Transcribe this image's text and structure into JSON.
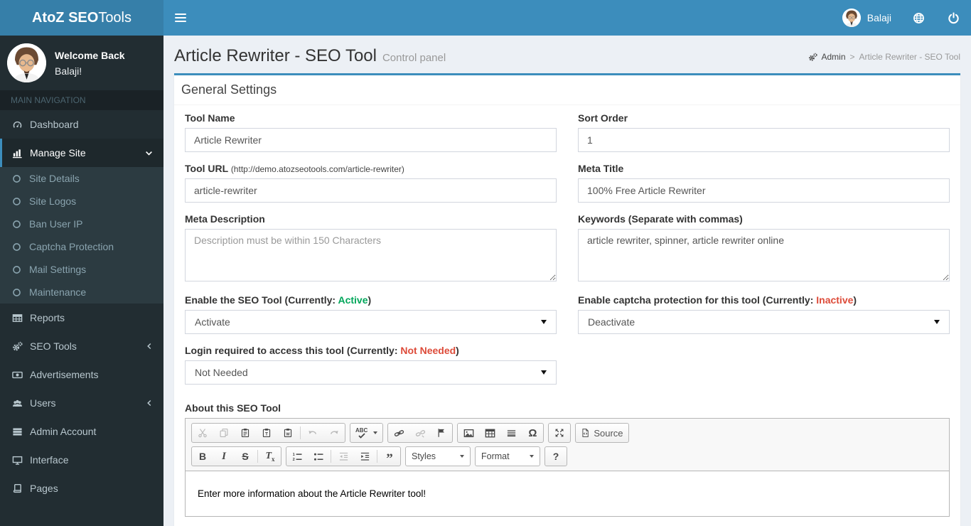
{
  "header": {
    "logo": {
      "bold": "AtoZ SEO",
      "light": "Tools"
    },
    "user_name": "Balaji"
  },
  "sidebar": {
    "welcome_title": "Welcome Back",
    "welcome_name": "Balaji!",
    "section_header": "MAIN NAVIGATION",
    "items": [
      {
        "label": "Dashboard"
      },
      {
        "label": "Manage Site"
      },
      {
        "label": "Reports"
      },
      {
        "label": "SEO Tools"
      },
      {
        "label": "Advertisements"
      },
      {
        "label": "Users"
      },
      {
        "label": "Admin Account"
      },
      {
        "label": "Interface"
      },
      {
        "label": "Pages"
      }
    ],
    "manage_site_submenu": [
      {
        "label": "Site Details"
      },
      {
        "label": "Site Logos"
      },
      {
        "label": "Ban User IP"
      },
      {
        "label": "Captcha Protection"
      },
      {
        "label": "Mail Settings"
      },
      {
        "label": "Maintenance"
      }
    ]
  },
  "page": {
    "title": "Article Rewriter - SEO Tool",
    "subtitle": "Control panel",
    "breadcrumb": {
      "root": "Admin",
      "separator": ">",
      "current": "Article Rewriter - SEO Tool"
    }
  },
  "panel": {
    "title": "General Settings"
  },
  "form": {
    "tool_name": {
      "label": "Tool Name",
      "value": "Article Rewriter"
    },
    "sort_order": {
      "label": "Sort Order",
      "value": "1"
    },
    "tool_url": {
      "label": "Tool URL",
      "hint": "(http://demo.atozseotools.com/article-rewriter)",
      "value": "article-rewriter"
    },
    "meta_title": {
      "label": "Meta Title",
      "value": "100% Free Article Rewriter"
    },
    "meta_description": {
      "label": "Meta Description",
      "placeholder": "Description must be within 150 Characters"
    },
    "keywords": {
      "label": "Keywords (Separate with commas)",
      "value": "article rewriter, spinner, article rewriter online"
    },
    "enable_tool": {
      "label_prefix": "Enable the SEO Tool (Currently: ",
      "status": "Active",
      "label_suffix": ")",
      "selected": "Activate"
    },
    "captcha": {
      "label_prefix": "Enable captcha protection for this tool (Currently: ",
      "status": "Inactive",
      "label_suffix": ")",
      "selected": "Deactivate"
    },
    "login": {
      "label_prefix": "Login required to access this tool (Currently: ",
      "status": "Not Needed",
      "label_suffix": ")",
      "selected": "Not Needed"
    },
    "about": {
      "label": "About this SEO Tool",
      "content": "Enter more information about the Article Rewriter tool!"
    }
  },
  "editor": {
    "source_label": "Source",
    "styles_label": "Styles",
    "format_label": "Format",
    "help_label": "?",
    "spell_label": "ABC",
    "bold_label": "B",
    "italic_label": "I",
    "strike_label": "S",
    "removeformat_letter": "T",
    "removeformat_sub": "x",
    "paste_text_letter": "T",
    "paste_word_letter": "W",
    "omega_label": "Ω",
    "quote_label": "”",
    "ol_num1": "1",
    "ol_num2": "2"
  },
  "colors": {
    "navbar": "#3c8dbc",
    "logo_bg": "#367fa9",
    "sidebar_bg": "#222d32",
    "submenu_bg": "#2c3b41",
    "active_accent": "#3c8dbc",
    "status_active_green": "#00a65a",
    "status_inactive_red": "#dd4b39",
    "content_bg": "#ecf0f5"
  }
}
